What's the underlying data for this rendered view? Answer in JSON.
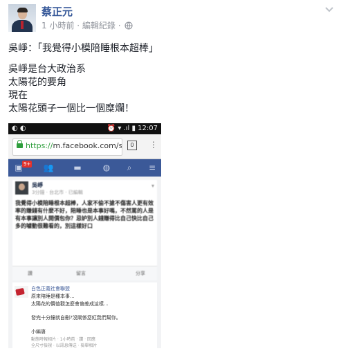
{
  "post": {
    "author": "蔡正元",
    "time": "1 小時前",
    "separator": " · ",
    "edit_history": "編輯紀錄",
    "lines": [
      "吳崢：「我覺得小模陪睡根本超棒」",
      "吳崢是台大政治系",
      "太陽花的要角",
      "現在",
      "太陽花頭子一個比一個糜爛！"
    ]
  },
  "screenshot": {
    "status_left": "◐ ◐",
    "status_right": "⏰ ▾ .ıl ▮ 12:07",
    "url_scheme": "https://",
    "url_host": "m.facebook.com/stc",
    "tab_count": "0",
    "menu_glyph": "⋮",
    "nav_badge": "9+",
    "inner_post": {
      "name": "吳崢",
      "meta": "3分鐘 · 台北市 · 已編輯",
      "body": "我覺得小模陪睡根本超棒，人家不偷不搶不傷害人更有效率的賺錢有什麼不好，陪睡也是本事好嗎，不然罵的人是有本事讓別人開價包你？忌妒別人錢賺得比自己快比自己多的噱動很難看的，別這樣好口",
      "like": "讚",
      "comment": "留言",
      "share": "分享"
    },
    "share_card": {
      "name": "白色正義社會聯盟",
      "line1": "原來陪睡是種本事...",
      "line2": "太陽花的價值觀怎麼會偏差成這樣...",
      "line3": "發完十分鐘就自刪?沒關係您紅我們幫你。",
      "line4": "小編唐",
      "foot1": "動態時報相片 · 1小時前 · 讚 · 回應",
      "foot2": "全尺寸檢視 · 以訊息傳送 · 檢舉相片"
    }
  },
  "colors": {
    "link": "#365899",
    "fb_blue": "#3b5998",
    "meta_gray": "#90949c"
  }
}
